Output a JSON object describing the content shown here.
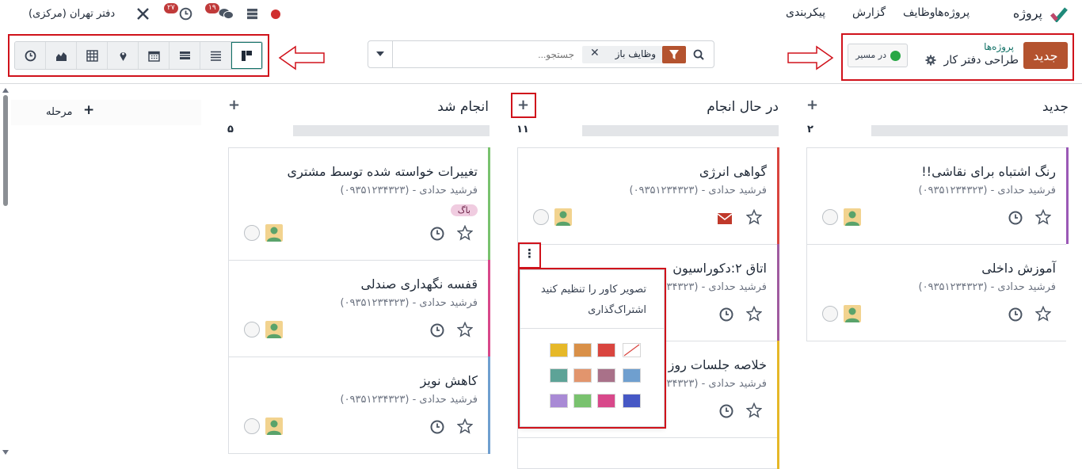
{
  "navbar": {
    "app_name": "پروژه",
    "menu": [
      "پروژه‌ها",
      "وظایف",
      "گزارش",
      "پیکربندی"
    ],
    "company": "دفتر تهران (مرکزی)",
    "activity_count": "۲۷",
    "message_count": "۱۹"
  },
  "control": {
    "new_label": "جدید",
    "breadcrumb_parent": "پروژه‌ها",
    "breadcrumb_current": "طراحی دفتر کار",
    "status_label": "در مسیر",
    "search_placeholder": "جستجو...",
    "facet_label": "وظایف باز",
    "views": [
      "kanban",
      "list",
      "gantt",
      "calendar",
      "map",
      "pivot",
      "graph",
      "activity"
    ]
  },
  "columns": [
    {
      "title": "جدید",
      "count": "۲",
      "cards": [
        {
          "title": "رنگ اشتباه برای نقاشی!!",
          "subtitle": "فرشید حدادی - (۰۹۳۵۱۲۳۴۳۲۳)",
          "color": "#9b59b6"
        },
        {
          "title": "آموزش داخلی",
          "subtitle": "فرشید حدادی - (۰۹۳۵۱۲۳۴۳۲۳)",
          "color": "#ffffff"
        }
      ]
    },
    {
      "title": "در حال انجام",
      "count": "۱۱",
      "cards": [
        {
          "title": "گواهی انرژی",
          "subtitle": "فرشید حدادی - (۰۹۳۵۱۲۳۴۳۲۳)",
          "color": "#d9453f"
        },
        {
          "title": "اتاق ۲:دکوراسیون",
          "subtitle": "فرشید حدادی - (۰۹۳۵۱۲۳۴۳۲۳)",
          "color": "#a05ca0"
        },
        {
          "title": "خلاصه جلسات روز",
          "subtitle": "فرشید حدادی - (۰۹۳۵۱۲۳۴۳۲۳)",
          "color": "#e6b828"
        }
      ]
    },
    {
      "title": "انجام شد",
      "count": "۵",
      "cards": [
        {
          "title": "تغییرات خواسته شده توسط مشتری",
          "subtitle": "فرشید حدادی - (۰۹۳۵۱۲۳۴۳۲۳)",
          "tag": "باگ",
          "color": "#79c26e"
        },
        {
          "title": "قفسه نگهداری صندلی",
          "subtitle": "فرشید حدادی - (۰۹۳۵۱۲۳۴۳۲۳)",
          "color": "#d8488a"
        },
        {
          "title": "کاهش نویز",
          "subtitle": "فرشید حدادی - (۰۹۳۵۱۲۳۴۳۲۳)",
          "color": "#6f9fcf"
        }
      ]
    }
  ],
  "add_stage": "مرحله",
  "dropdown": {
    "items": [
      "تصویر کاور را تنظیم کنید",
      "اشتراک‌گذاری"
    ],
    "colors": [
      "none",
      "#d9453f",
      "#d99048",
      "#e6b828",
      "#6f9fcf",
      "#a97189",
      "#e2956d",
      "#5da397",
      "#4658c5",
      "#d8488a",
      "#79c26e",
      "#a98ad5"
    ]
  }
}
